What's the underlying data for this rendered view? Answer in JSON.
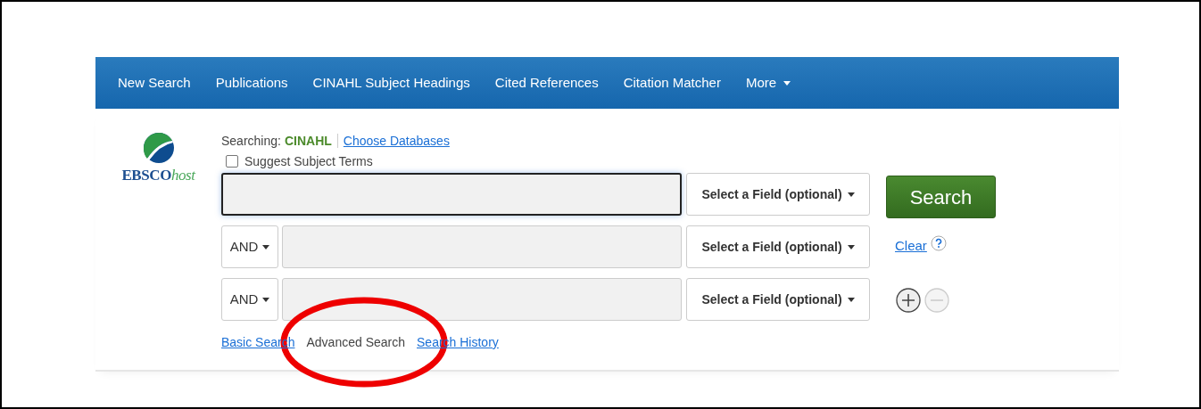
{
  "nav": [
    {
      "label": "New Search",
      "has_menu": false
    },
    {
      "label": "Publications",
      "has_menu": false
    },
    {
      "label": "CINAHL Subject Headings",
      "has_menu": false
    },
    {
      "label": "Cited References",
      "has_menu": false
    },
    {
      "label": "Citation Matcher",
      "has_menu": false
    },
    {
      "label": "More",
      "has_menu": true
    }
  ],
  "logo": {
    "brand": "EBSCO",
    "suffix": "host"
  },
  "searching": {
    "label": "Searching:",
    "database": "CINAHL",
    "link": "Choose Databases"
  },
  "suggest": {
    "label": "Suggest Subject Terms",
    "checked": false
  },
  "rows": [
    {
      "operator": null,
      "field": "Select a Field (optional)",
      "focused": true
    },
    {
      "operator": "AND",
      "field": "Select a Field (optional)",
      "focused": false
    },
    {
      "operator": "AND",
      "field": "Select a Field (optional)",
      "focused": false
    }
  ],
  "search_button": "Search",
  "clear": "Clear",
  "add_row": {
    "disabled": false
  },
  "remove_row": {
    "disabled": true
  },
  "modes": [
    {
      "label": "Basic Search",
      "selected": false
    },
    {
      "label": "Advanced Search",
      "selected": true
    },
    {
      "label": "Search History",
      "selected": false
    }
  ]
}
